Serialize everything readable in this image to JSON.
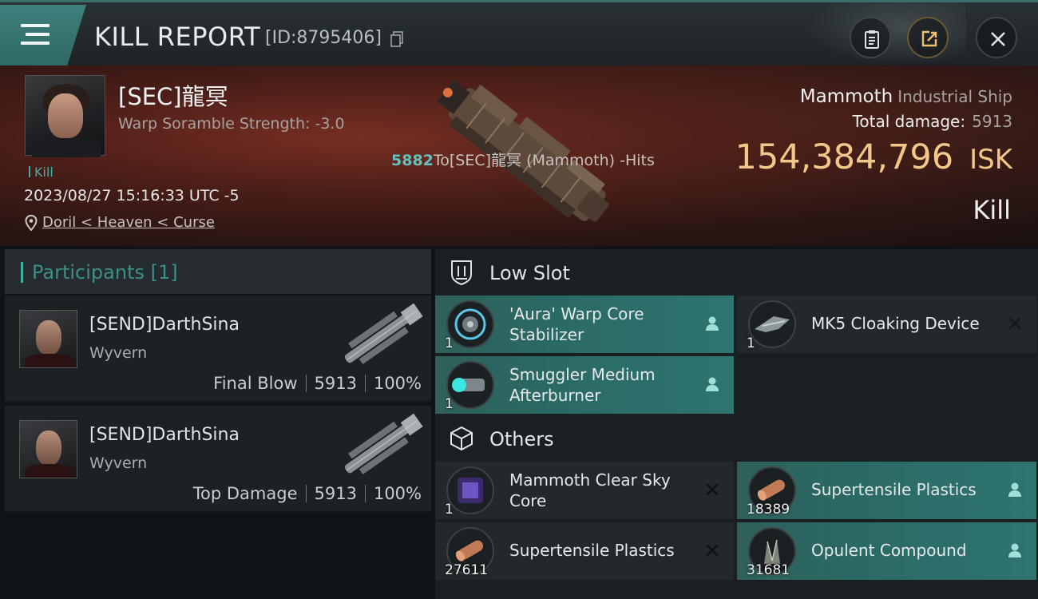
{
  "header": {
    "title": "KILL REPORT",
    "report_id": "[ID:8795406]"
  },
  "victim": {
    "name": "[SEC]龍冥",
    "warp_scramble": "Warp Soramble Strength: -3.0",
    "kill_tag": "Kill",
    "timestamp": "2023/08/27 15:16:33 UTC -5",
    "location": "Doril < Heaven < Curse",
    "ship_name": "Mammoth",
    "ship_class": "Industrial Ship",
    "total_damage_label": "Total damage:",
    "total_damage": "5913",
    "isk_value": "154,384,796",
    "isk_unit": "ISK",
    "result": "Kill"
  },
  "hits": {
    "count": "5882",
    "text": "To[SEC]龍冥 (Mammoth) -Hits"
  },
  "participants": {
    "header": "Participants [1]",
    "list": [
      {
        "name": "[SEND]DarthSina",
        "ship": "Wyvern",
        "role": "Final Blow",
        "damage": "5913",
        "percent": "100%"
      },
      {
        "name": "[SEND]DarthSina",
        "ship": "Wyvern",
        "role": "Top Damage",
        "damage": "5913",
        "percent": "100%"
      }
    ]
  },
  "low_slot": {
    "title": "Low Slot",
    "items": [
      {
        "name": "'Aura' Warp Core Stabilizer",
        "qty": "1",
        "status": "dropped"
      },
      {
        "name": "MK5 Cloaking Device",
        "qty": "1",
        "status": "destroyed"
      },
      {
        "name": "Smuggler Medium Afterburner",
        "qty": "1",
        "status": "dropped"
      }
    ]
  },
  "others": {
    "title": "Others",
    "items": [
      {
        "name": "Mammoth Clear Sky Core",
        "qty": "1",
        "status": "destroyed"
      },
      {
        "name": "Supertensile Plastics",
        "qty": "18389",
        "status": "dropped"
      },
      {
        "name": "Supertensile Plastics",
        "qty": "27611",
        "status": "destroyed"
      },
      {
        "name": "Opulent Compound",
        "qty": "31681",
        "status": "dropped"
      }
    ]
  },
  "colors": {
    "accent": "#3fb0a6",
    "isk": "#f2c88a",
    "dropped_bg": "#2f6964",
    "hero_red": "#7a2f22"
  }
}
